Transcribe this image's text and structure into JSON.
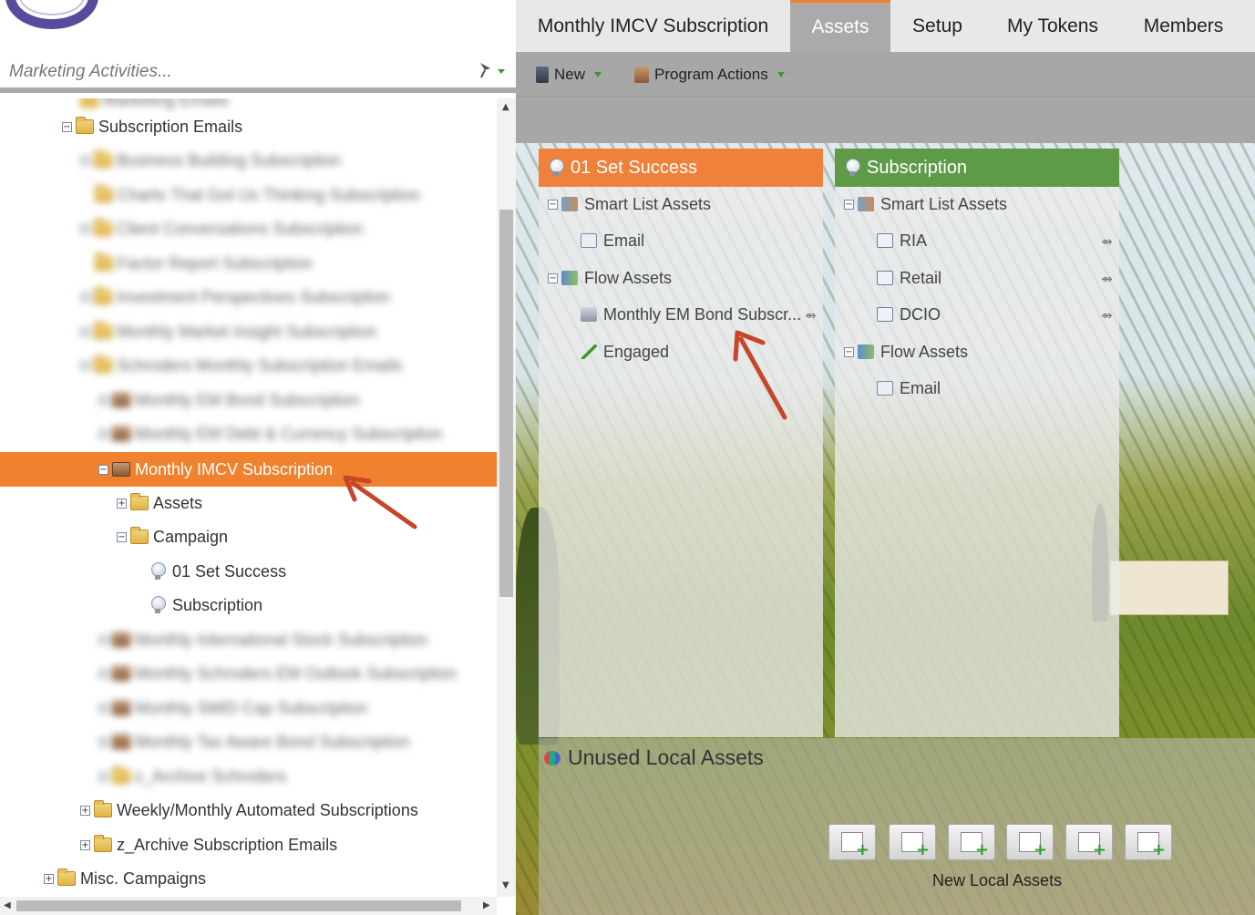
{
  "search": {
    "placeholder": "Marketing Activities..."
  },
  "tree": {
    "items": [
      {
        "label": "Subscription Emails"
      },
      {
        "label": "Business Building Subscription"
      },
      {
        "label": "Charts That Got Us Thinking Subscription"
      },
      {
        "label": "Client Conversations Subscription"
      },
      {
        "label": "Factor Report Subscription"
      },
      {
        "label": "Investment Perspectives Subscription"
      },
      {
        "label": "Monthly Market Insight Subscription"
      },
      {
        "label": "Schroders Monthly Subscription Emails"
      },
      {
        "label": "Monthly EM Bond Subscription"
      },
      {
        "label": "Monthly EM Debt & Currency Subscription"
      },
      {
        "label": "Monthly IMCV Subscription"
      },
      {
        "label": "Assets"
      },
      {
        "label": "Campaign"
      },
      {
        "label": "01 Set Success"
      },
      {
        "label": "Subscription"
      },
      {
        "label": "Monthly International Stock Subscription"
      },
      {
        "label": "Monthly Schroders EM Outlook Subscription"
      },
      {
        "label": "Monthly SMID Cap Subscription"
      },
      {
        "label": "Monthly Tax Aware Bond Subscription"
      },
      {
        "label": "z_Archive Schroders"
      },
      {
        "label": "Weekly/Monthly Automated Subscriptions"
      },
      {
        "label": "z_Archive Subscription Emails"
      },
      {
        "label": "Misc. Campaigns"
      }
    ]
  },
  "tabs": [
    {
      "label": "Monthly IMCV Subscription"
    },
    {
      "label": "Assets"
    },
    {
      "label": "Setup"
    },
    {
      "label": "My Tokens"
    },
    {
      "label": "Members"
    }
  ],
  "toolbar": {
    "new_label": "New",
    "program_actions_label": "Program Actions"
  },
  "columns": {
    "set_success": {
      "title": "01 Set Success",
      "smart_list_label": "Smart List Assets",
      "email_label": "Email",
      "flow_label": "Flow Assets",
      "flow_item_label": "Monthly EM Bond Subscr...",
      "engaged_label": "Engaged",
      "color": "#f0813a"
    },
    "subscription": {
      "title": "Subscription",
      "smart_list_label": "Smart List Assets",
      "list_items": [
        {
          "label": "RIA"
        },
        {
          "label": "Retail"
        },
        {
          "label": "DCIO"
        }
      ],
      "flow_label": "Flow Assets",
      "email_label": "Email",
      "color": "#5f9a48"
    }
  },
  "unused": {
    "title": "Unused Local Assets",
    "new_local_label": "New Local Assets"
  },
  "colors": {
    "accent": "#f0812e",
    "tab_active_bg": "#aaaaaa",
    "toolbar_bg": "#a7a7a7"
  }
}
